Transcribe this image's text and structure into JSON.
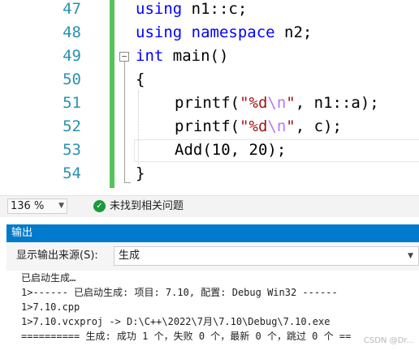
{
  "editor": {
    "lines": [
      {
        "num": "47",
        "t1": "using",
        "t2": " n1::c;"
      },
      {
        "num": "48",
        "t1": "using namespace",
        "t2": " n2;"
      },
      {
        "num": "49",
        "t1": "int",
        "t2": " main()"
      },
      {
        "num": "50",
        "t1": "{"
      },
      {
        "num": "51",
        "t1": "printf(",
        "t2": "\"%d",
        "t3": "\\n",
        "t4": "\"",
        "t5": ", n1::a);"
      },
      {
        "num": "52",
        "t1": "printf(",
        "t2": "\"%d",
        "t3": "\\n",
        "t4": "\"",
        "t5": ", c);"
      },
      {
        "num": "53",
        "t1": "Add(10, 20);"
      },
      {
        "num": "54",
        "t1": "}"
      }
    ],
    "fold_glyph": "−"
  },
  "statusbar": {
    "zoom": "136 %",
    "issues": "未找到相关问题",
    "ok_icon": "✓"
  },
  "output": {
    "title": "输出",
    "source_label": "显示输出来源(S):",
    "source_value": "生成",
    "lines": [
      "已启动生成…",
      "1>------ 已启动生成: 项目: 7.10, 配置: Debug Win32 ------",
      "1>7.10.cpp",
      "1>7.10.vcxproj -> D:\\C++\\2022\\7月\\7.10\\Debug\\7.10.exe",
      "========== 生成: 成功 1 个，失败 0 个，最新 0 个，跳过 0 个 =="
    ],
    "watermark": "CSDN @Dr..."
  },
  "colors": {
    "keyword": "#0000ff",
    "string": "#a31515",
    "escape": "#b776fb",
    "line_number": "#2b91af",
    "change_bar": "#57c25b",
    "output_header": "#007acc"
  }
}
